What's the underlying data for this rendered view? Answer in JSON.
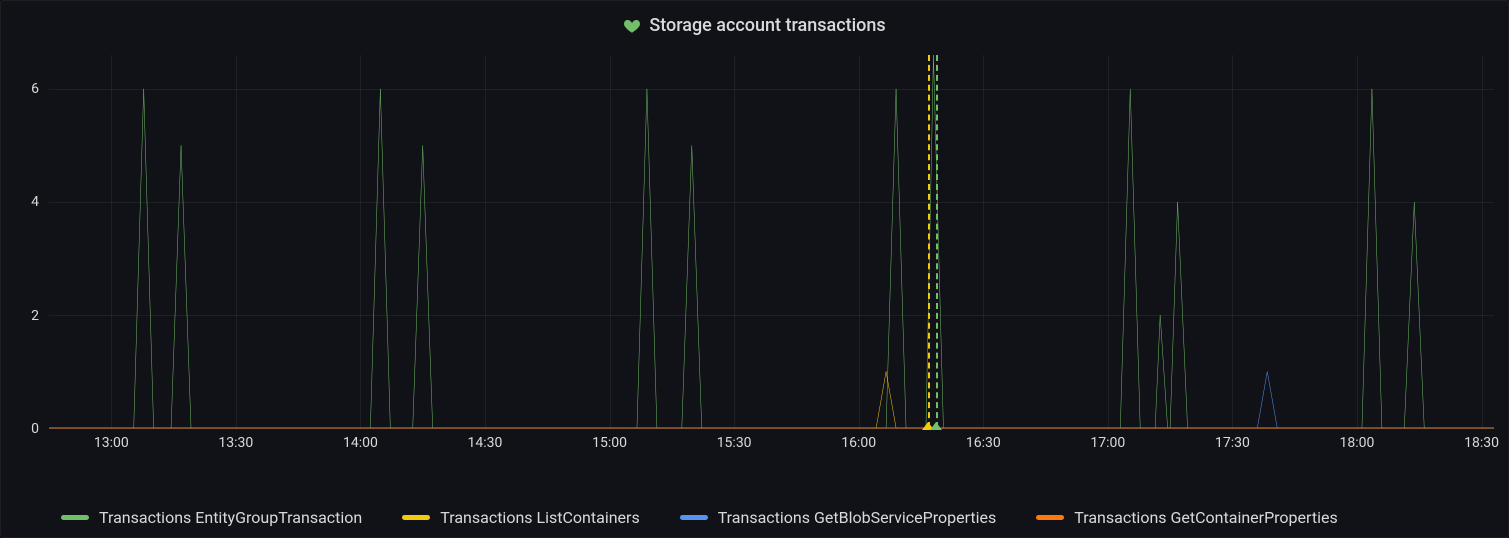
{
  "title": "Storage account transactions",
  "icon": "heart-icon",
  "colors": {
    "green": "#73BF69",
    "yellow": "#F2CC0C",
    "blue": "#5794F2",
    "orange": "#FF780A"
  },
  "legend": [
    {
      "label": "Transactions EntityGroupTransaction",
      "color": "green"
    },
    {
      "label": "Transactions ListContainers",
      "color": "yellow"
    },
    {
      "label": "Transactions GetBlobServiceProperties",
      "color": "blue"
    },
    {
      "label": "Transactions GetContainerProperties",
      "color": "orange"
    }
  ],
  "annotations": [
    {
      "x": 16.28,
      "color": "yellow"
    },
    {
      "x": 16.31,
      "color": "green"
    }
  ],
  "chart_data": {
    "type": "line",
    "xlabel": "",
    "ylabel": "",
    "ylim": [
      0,
      6.6
    ],
    "x_ticks": [
      "13:00",
      "13:30",
      "14:00",
      "14:30",
      "15:00",
      "15:30",
      "16:00",
      "16:30",
      "17:00",
      "17:30",
      "18:00",
      "18:30"
    ],
    "x_range": [
      12.75,
      18.55
    ],
    "y_ticks": [
      0,
      2,
      4,
      6
    ],
    "series": [
      {
        "name": "Transactions EntityGroupTransaction",
        "colorKey": "green",
        "points": [
          [
            12.75,
            0
          ],
          [
            13.09,
            0
          ],
          [
            13.13,
            6
          ],
          [
            13.17,
            0
          ],
          [
            13.24,
            0
          ],
          [
            13.28,
            5
          ],
          [
            13.32,
            0
          ],
          [
            14.04,
            0
          ],
          [
            14.08,
            6
          ],
          [
            14.12,
            0
          ],
          [
            14.21,
            0
          ],
          [
            14.25,
            5
          ],
          [
            14.29,
            0
          ],
          [
            15.11,
            0
          ],
          [
            15.15,
            6
          ],
          [
            15.19,
            0
          ],
          [
            15.29,
            0
          ],
          [
            15.33,
            5
          ],
          [
            15.37,
            0
          ],
          [
            16.11,
            0
          ],
          [
            16.15,
            6
          ],
          [
            16.19,
            0
          ],
          [
            16.27,
            0
          ],
          [
            16.3,
            6.6
          ],
          [
            16.34,
            0
          ],
          [
            17.05,
            0
          ],
          [
            17.09,
            6
          ],
          [
            17.13,
            0
          ],
          [
            17.19,
            0
          ],
          [
            17.21,
            2
          ],
          [
            17.24,
            0
          ],
          [
            17.25,
            0
          ],
          [
            17.28,
            4
          ],
          [
            17.32,
            0
          ],
          [
            18.02,
            0
          ],
          [
            18.06,
            6
          ],
          [
            18.1,
            0
          ],
          [
            18.19,
            0
          ],
          [
            18.23,
            4
          ],
          [
            18.27,
            0
          ],
          [
            18.55,
            0
          ]
        ]
      },
      {
        "name": "Transactions ListContainers",
        "colorKey": "yellow",
        "points": [
          [
            12.75,
            0
          ],
          [
            16.07,
            0
          ],
          [
            16.11,
            1
          ],
          [
            16.15,
            0
          ],
          [
            18.55,
            0
          ]
        ]
      },
      {
        "name": "Transactions GetBlobServiceProperties",
        "colorKey": "blue",
        "points": [
          [
            12.75,
            0
          ],
          [
            17.6,
            0
          ],
          [
            17.64,
            1
          ],
          [
            17.68,
            0
          ],
          [
            18.55,
            0
          ]
        ]
      },
      {
        "name": "Transactions GetContainerProperties",
        "colorKey": "orange",
        "points": [
          [
            12.75,
            0
          ],
          [
            18.55,
            0
          ]
        ]
      }
    ]
  }
}
